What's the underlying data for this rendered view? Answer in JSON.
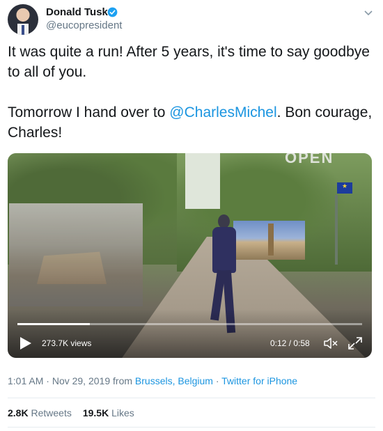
{
  "author": {
    "name": "Donald Tusk",
    "handle": "@eucopresident",
    "verified": true
  },
  "tweet": {
    "line1": "It was quite a run! After 5 years, it's time to say goodbye to all of you.",
    "line2_prefix": "Tomorrow I hand over to ",
    "mention": "@CharlesMichel",
    "line2_suffix": ". Bon courage, Charles!"
  },
  "video": {
    "views": "273.7K views",
    "time": "0:12 / 0:58",
    "progress": 0.21,
    "overlay_text": "OPEN"
  },
  "meta": {
    "time": "1:01 AM",
    "date": "Nov 29, 2019",
    "from_label": "from",
    "location": "Brussels, Belgium",
    "source": "Twitter for iPhone"
  },
  "stats": {
    "retweets_count": "2.8K",
    "retweets_label": "Retweets",
    "likes_count": "19.5K",
    "likes_label": "Likes"
  },
  "colors": {
    "link": "#1b95e0",
    "secondary_text": "#657786",
    "verified": "#1da1f2"
  },
  "icons": [
    "verified-badge-icon",
    "chevron-down-icon",
    "play-icon",
    "mute-icon",
    "fullscreen-icon"
  ]
}
